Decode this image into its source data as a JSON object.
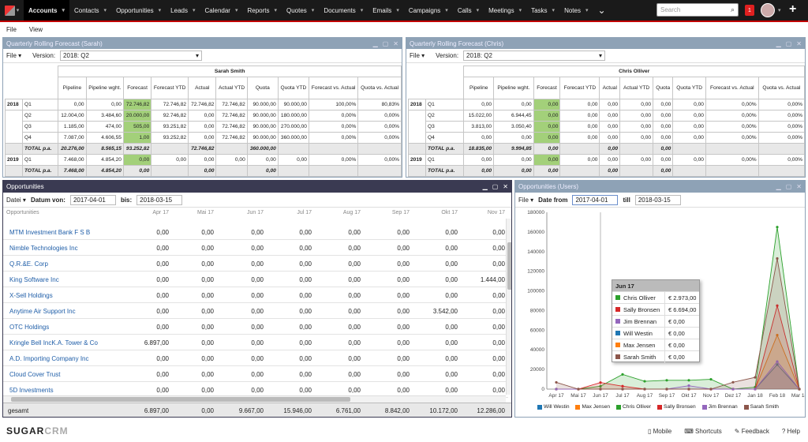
{
  "nav": {
    "items": [
      "Accounts",
      "Contacts",
      "Opportunities",
      "Leads",
      "Calendar",
      "Reports",
      "Quotes",
      "Documents",
      "Emails",
      "Campaigns",
      "Calls",
      "Meetings",
      "Tasks",
      "Notes"
    ],
    "search_placeholder": "Search",
    "notification_count": "1"
  },
  "menubar": {
    "file": "File",
    "view": "View"
  },
  "forecast_sarah": {
    "title": "Quarterly Rolling Forecast (Sarah)",
    "file": "File",
    "version_label": "Version:",
    "version_value": "2018: Q2",
    "person": "Sarah Smith",
    "columns": [
      "Pipeline",
      "Pipeline wght.",
      "Forecast",
      "Forecast YTD",
      "Actual",
      "Actual YTD",
      "Quota",
      "Quota YTD",
      "Forecast vs. Actual",
      "Quota vs. Actual"
    ],
    "rows": [
      {
        "year": "2018",
        "q": "Q1",
        "v": [
          "0,00",
          "0,00",
          "72.746,82",
          "72.746,82",
          "72.746,82",
          "72.746,82",
          "90.000,00",
          "90.000,00",
          "100,00%",
          "80,83%"
        ]
      },
      {
        "year": "",
        "q": "Q2",
        "v": [
          "12.004,00",
          "3.484,60",
          "20.000,00",
          "92.746,82",
          "0,00",
          "72.746,82",
          "90.000,00",
          "180.000,00",
          "0,00%",
          "0,00%"
        ]
      },
      {
        "year": "",
        "q": "Q3",
        "v": [
          "1.185,00",
          "474,00",
          "505,00",
          "93.251,82",
          "0,00",
          "72.746,82",
          "90.000,00",
          "270.000,00",
          "0,00%",
          "0,00%"
        ]
      },
      {
        "year": "",
        "q": "Q4",
        "v": [
          "7.087,00",
          "4.606,55",
          "1,00",
          "93.252,82",
          "0,00",
          "72.746,82",
          "90.000,00",
          "360.000,00",
          "0,00%",
          "0,00%"
        ]
      },
      {
        "year": "",
        "q": "TOTAL p.a.",
        "total": true,
        "v": [
          "20.276,00",
          "8.565,15",
          "93.252,82",
          "",
          "72.746,82",
          "",
          "360.000,00",
          "",
          "",
          ""
        ]
      },
      {
        "year": "2019",
        "q": "Q1",
        "v": [
          "7.468,00",
          "4.854,20",
          "0,00",
          "0,00",
          "0,00",
          "0,00",
          "0,00",
          "0,00",
          "0,00%",
          "0,00%"
        ]
      },
      {
        "year": "",
        "q": "TOTAL p.a.",
        "total": true,
        "v": [
          "7.468,00",
          "4.854,20",
          "0,00",
          "",
          "0,00",
          "",
          "0,00",
          "",
          "",
          ""
        ]
      }
    ]
  },
  "forecast_chris": {
    "title": "Quarterly Rolling Forecast (Chris)",
    "file": "File",
    "version_label": "Version:",
    "version_value": "2018: Q2",
    "person": "Chris Olliver",
    "columns": [
      "Pipeline",
      "Pipeline wght.",
      "Forecast",
      "Forecast YTD",
      "Actual",
      "Actual YTD",
      "Quota",
      "Quota YTD",
      "Forecast vs. Actual",
      "Quota vs. Actual"
    ],
    "rows": [
      {
        "year": "2018",
        "q": "Q1",
        "v": [
          "0,00",
          "0,00",
          "0,00",
          "0,00",
          "0,00",
          "0,00",
          "0,00",
          "0,00",
          "0,00%",
          "0,00%"
        ]
      },
      {
        "year": "",
        "q": "Q2",
        "v": [
          "15.022,00",
          "6.944,45",
          "0,00",
          "0,00",
          "0,00",
          "0,00",
          "0,00",
          "0,00",
          "0,00%",
          "0,00%"
        ]
      },
      {
        "year": "",
        "q": "Q3",
        "v": [
          "3.813,00",
          "3.050,40",
          "0,00",
          "0,00",
          "0,00",
          "0,00",
          "0,00",
          "0,00",
          "0,00%",
          "0,00%"
        ]
      },
      {
        "year": "",
        "q": "Q4",
        "v": [
          "0,00",
          "0,00",
          "0,00",
          "0,00",
          "0,00",
          "0,00",
          "0,00",
          "0,00",
          "0,00%",
          "0,00%"
        ]
      },
      {
        "year": "",
        "q": "TOTAL p.a.",
        "total": true,
        "v": [
          "18.835,00",
          "9.994,85",
          "0,00",
          "",
          "0,00",
          "",
          "0,00",
          "",
          "",
          ""
        ]
      },
      {
        "year": "2019",
        "q": "Q1",
        "v": [
          "0,00",
          "0,00",
          "0,00",
          "0,00",
          "0,00",
          "0,00",
          "0,00",
          "0,00",
          "0,00%",
          "0,00%"
        ]
      },
      {
        "year": "",
        "q": "TOTAL p.a.",
        "total": true,
        "v": [
          "0,00",
          "0,00",
          "0,00",
          "",
          "0,00",
          "",
          "0,00",
          "",
          "",
          ""
        ]
      }
    ]
  },
  "opportunities": {
    "title": "Opportunities",
    "file": "Datei",
    "from_label": "Datum von:",
    "from_value": "2017-04-01",
    "to_label": "bis:",
    "to_value": "2018-03-15",
    "col_label": "Opportunities",
    "months": [
      "Apr 17",
      "Mai 17",
      "Jun 17",
      "Jul 17",
      "Aug 17",
      "Sep 17",
      "Okt 17",
      "Nov 17"
    ],
    "rows": [
      {
        "name": "MTM Investment Bank F S B",
        "v": [
          "0,00",
          "0,00",
          "0,00",
          "0,00",
          "0,00",
          "0,00",
          "0,00",
          "0,00"
        ]
      },
      {
        "name": "Nimble Technologies Inc",
        "v": [
          "0,00",
          "0,00",
          "0,00",
          "0,00",
          "0,00",
          "0,00",
          "0,00",
          "0,00"
        ]
      },
      {
        "name": "Q.R.&E. Corp",
        "v": [
          "0,00",
          "0,00",
          "0,00",
          "0,00",
          "0,00",
          "0,00",
          "0,00",
          "0,00"
        ]
      },
      {
        "name": "King Software Inc",
        "v": [
          "0,00",
          "0,00",
          "0,00",
          "0,00",
          "0,00",
          "0,00",
          "0,00",
          "1.444,00"
        ]
      },
      {
        "name": "X-Sell Holdings",
        "v": [
          "0,00",
          "0,00",
          "0,00",
          "0,00",
          "0,00",
          "0,00",
          "0,00",
          "0,00"
        ]
      },
      {
        "name": "Anytime Air Support Inc",
        "v": [
          "0,00",
          "0,00",
          "0,00",
          "0,00",
          "0,00",
          "0,00",
          "3.542,00",
          "0,00"
        ]
      },
      {
        "name": "OTC Holdings",
        "v": [
          "0,00",
          "0,00",
          "0,00",
          "0,00",
          "0,00",
          "0,00",
          "0,00",
          "0,00"
        ]
      },
      {
        "name": "Kringle Bell IncK.A. Tower & Co",
        "v": [
          "6.897,00",
          "0,00",
          "0,00",
          "0,00",
          "0,00",
          "0,00",
          "0,00",
          "0,00"
        ]
      },
      {
        "name": "A.D. Importing Company Inc",
        "v": [
          "0,00",
          "0,00",
          "0,00",
          "0,00",
          "0,00",
          "0,00",
          "0,00",
          "0,00"
        ]
      },
      {
        "name": "Cloud Cover Trust",
        "v": [
          "0,00",
          "0,00",
          "0,00",
          "0,00",
          "0,00",
          "0,00",
          "0,00",
          "0,00"
        ]
      },
      {
        "name": "5D Investments",
        "v": [
          "0,00",
          "0,00",
          "0,00",
          "0,00",
          "0,00",
          "0,00",
          "0,00",
          "0,00"
        ]
      }
    ],
    "total_label": "gesamt",
    "totals": [
      "6.897,00",
      "0,00",
      "9.667,00",
      "15.946,00",
      "6.761,00",
      "8.842,00",
      "10.172,00",
      "12.286,00"
    ]
  },
  "opp_users": {
    "title": "Opportunities (Users)",
    "file": "File",
    "from_label": "Date from",
    "from_value": "2017-04-01",
    "to_label": "till",
    "to_value": "2018-03-15",
    "tooltip": {
      "title": "Jun 17",
      "rows": [
        {
          "name": "Chris Olliver",
          "value": "€ 2.973,00",
          "color": "#2ca02c"
        },
        {
          "name": "Sally Bronsen",
          "value": "€ 6.694,00",
          "color": "#d62728"
        },
        {
          "name": "Jim Brennan",
          "value": "€ 0,00",
          "color": "#9467bd"
        },
        {
          "name": "Will Westin",
          "value": "€ 0,00",
          "color": "#1f77b4"
        },
        {
          "name": "Max Jensen",
          "value": "€ 0,00",
          "color": "#ff7f0e"
        },
        {
          "name": "Sarah Smith",
          "value": "€ 0,00",
          "color": "#8c564b"
        }
      ]
    }
  },
  "chart_data": {
    "type": "area",
    "x": [
      "Apr 17",
      "Mai 17",
      "Jun 17",
      "Jul 17",
      "Aug 17",
      "Sep 17",
      "Okt 17",
      "Nov 17",
      "Dez 17",
      "Jan 18",
      "Feb 18",
      "Mar 18"
    ],
    "ylim": [
      0,
      180000
    ],
    "yticks": [
      "0",
      "20000",
      "40000",
      "60000",
      "80000",
      "100000",
      "120000",
      "140000",
      "160000",
      "180000"
    ],
    "legend_position": "bottom",
    "series": [
      {
        "name": "Will Westin",
        "color": "#1f77b4",
        "values": [
          0,
          0,
          0,
          0,
          0,
          0,
          0,
          0,
          0,
          0,
          25000,
          0
        ]
      },
      {
        "name": "Max Jensen",
        "color": "#ff7f0e",
        "values": [
          0,
          0,
          0,
          0,
          0,
          0,
          0,
          0,
          0,
          0,
          55000,
          0
        ]
      },
      {
        "name": "Chris Olliver",
        "color": "#2ca02c",
        "values": [
          0,
          0,
          2973,
          15000,
          8000,
          9000,
          9000,
          10000,
          0,
          2000,
          165000,
          0
        ]
      },
      {
        "name": "Sally Bronsen",
        "color": "#d62728",
        "values": [
          0,
          0,
          6694,
          3000,
          0,
          0,
          0,
          0,
          0,
          0,
          85000,
          0
        ]
      },
      {
        "name": "Jim Brennan",
        "color": "#9467bd",
        "values": [
          0,
          0,
          0,
          0,
          0,
          0,
          3500,
          0,
          0,
          0,
          28000,
          0
        ]
      },
      {
        "name": "Sarah Smith",
        "color": "#8c564b",
        "values": [
          6897,
          0,
          0,
          0,
          0,
          0,
          0,
          0,
          7000,
          12000,
          133000,
          0
        ]
      }
    ]
  },
  "footer": {
    "brand_a": "SUGAR",
    "brand_b": "CRM",
    "links": [
      "Mobile",
      "Shortcuts",
      "Feedback",
      "Help"
    ]
  }
}
